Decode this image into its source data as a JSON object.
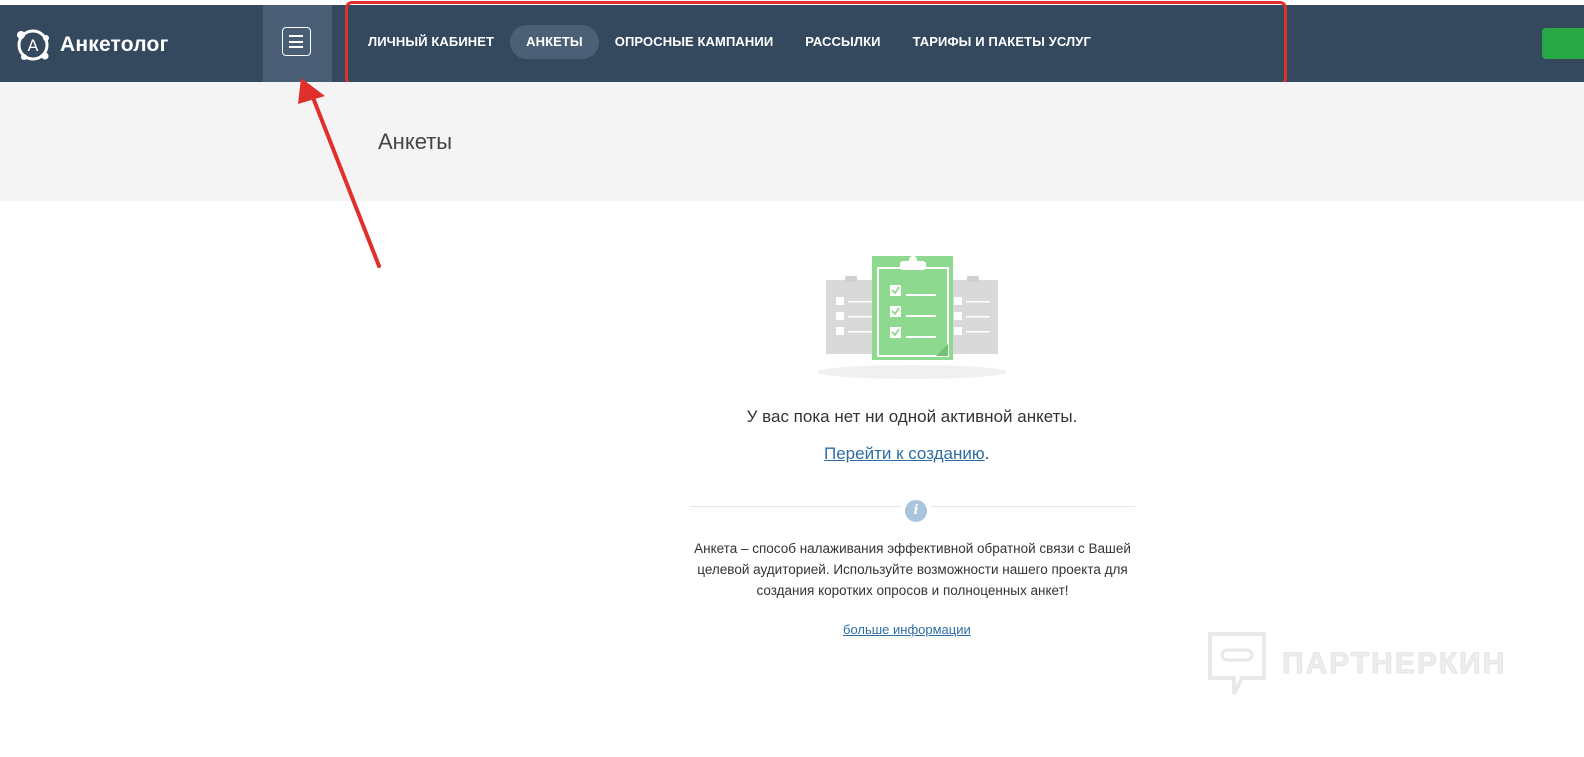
{
  "brand": {
    "name": "Анкетолог",
    "logo_letter": "A"
  },
  "nav": {
    "items": [
      {
        "label": "ЛИЧНЫЙ КАБИНЕТ",
        "active": false
      },
      {
        "label": "АНКЕТЫ",
        "active": true
      },
      {
        "label": "ОПРОСНЫЕ КАМПАНИИ",
        "active": false
      },
      {
        "label": "РАССЫЛКИ",
        "active": false
      },
      {
        "label": "ТАРИФЫ И ПАКЕТЫ УСЛУГ",
        "active": false
      }
    ]
  },
  "page": {
    "title": "Анкеты"
  },
  "empty_state": {
    "message": "У вас пока нет ни одной активной анкеты.",
    "create_link": "Перейти к созданию",
    "create_suffix": ".",
    "info_icon": "i",
    "description": "Анкета – способ налаживания эффективной обратной связи с Вашей целевой аудиторией. Используйте возможности нашего проекта для создания коротких опросов и полноценных анкет!",
    "more_link": "больше информации"
  },
  "watermark": {
    "text": "ПАРТНЕРКИН"
  },
  "colors": {
    "topbar": "#34495e",
    "active_pill": "#4b6076",
    "highlight": "#e0302b",
    "accent_green": "#28a745",
    "link": "#2e6da4",
    "clipboard_green": "#8dd98f"
  },
  "icons": [
    "logo-icon",
    "hamburger-menu-icon",
    "clipboard-checklist-icon",
    "info-icon",
    "watermark-chat-icon"
  ]
}
